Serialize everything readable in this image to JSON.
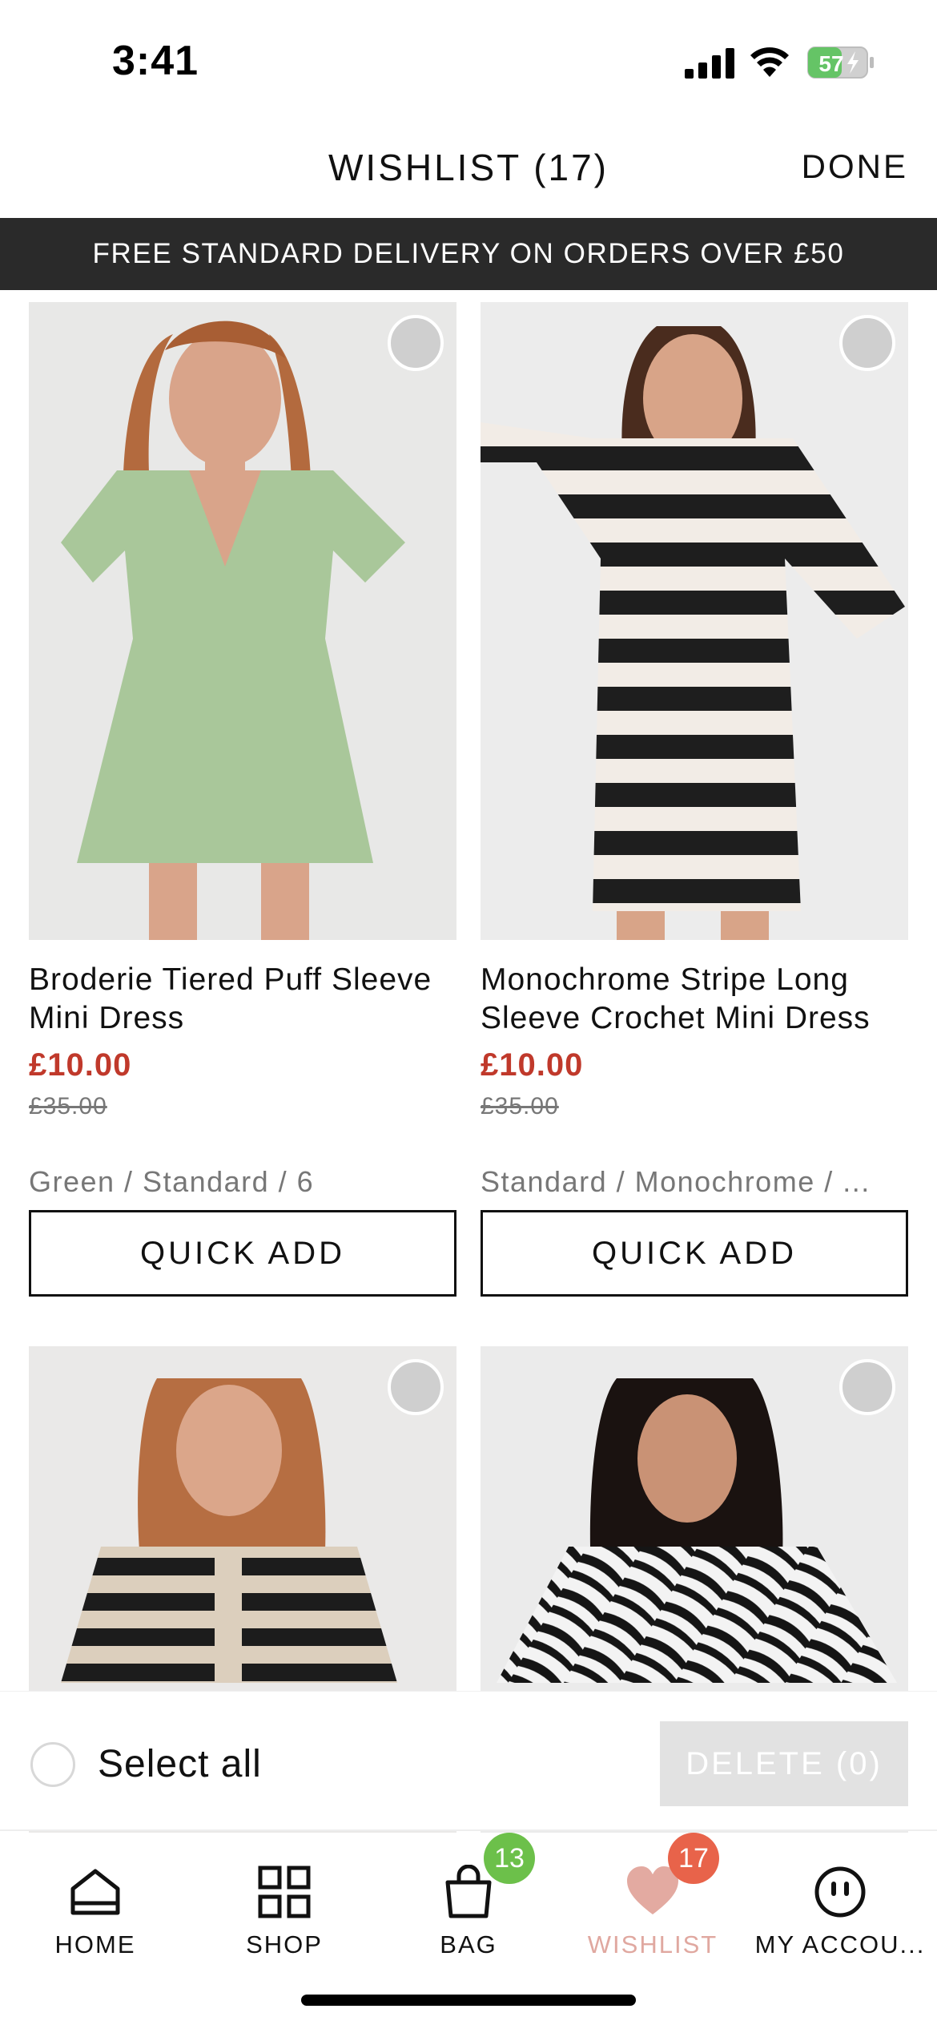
{
  "status_bar": {
    "time": "3:41",
    "battery_level": "57"
  },
  "header": {
    "title": "WISHLIST (17)",
    "done_label": "DONE"
  },
  "promo": {
    "text": "FREE STANDARD DELIVERY ON ORDERS OVER £50"
  },
  "products": [
    {
      "name": "Broderie Tiered Puff Sleeve Mini Dress",
      "sale_price": "£10.00",
      "original_price": "£35.00",
      "variant": "Green / Standard / 6",
      "quick_add_label": "QUICK ADD",
      "dress_color": "#a9c79a"
    },
    {
      "name": "Monochrome Stripe Long Sleeve Crochet Mini Dress",
      "sale_price": "£10.00",
      "original_price": "£35.00",
      "variant": "Standard / Monochrome / ...",
      "quick_add_label": "QUICK ADD",
      "dress_color": "#1e1e1e"
    },
    {
      "dress_color": "#d8cbb8"
    },
    {
      "dress_color": "#1a1a1a"
    }
  ],
  "selection_bar": {
    "select_all_label": "Select all",
    "delete_label": "DELETE (0)"
  },
  "tabs": [
    {
      "label": "HOME",
      "icon": "home-icon"
    },
    {
      "label": "SHOP",
      "icon": "grid-icon"
    },
    {
      "label": "BAG",
      "icon": "bag-icon",
      "badge": "13"
    },
    {
      "label": "WISHLIST",
      "icon": "heart-icon",
      "badge": "17",
      "active": true
    },
    {
      "label": "MY ACCOU...",
      "icon": "account-icon"
    }
  ],
  "colors": {
    "sale": "#c0392b",
    "banner": "#2a2a2a",
    "active_tab": "#e0a8a0",
    "bag_badge": "#6cc04a",
    "wishlist_badge": "#e8634a"
  }
}
